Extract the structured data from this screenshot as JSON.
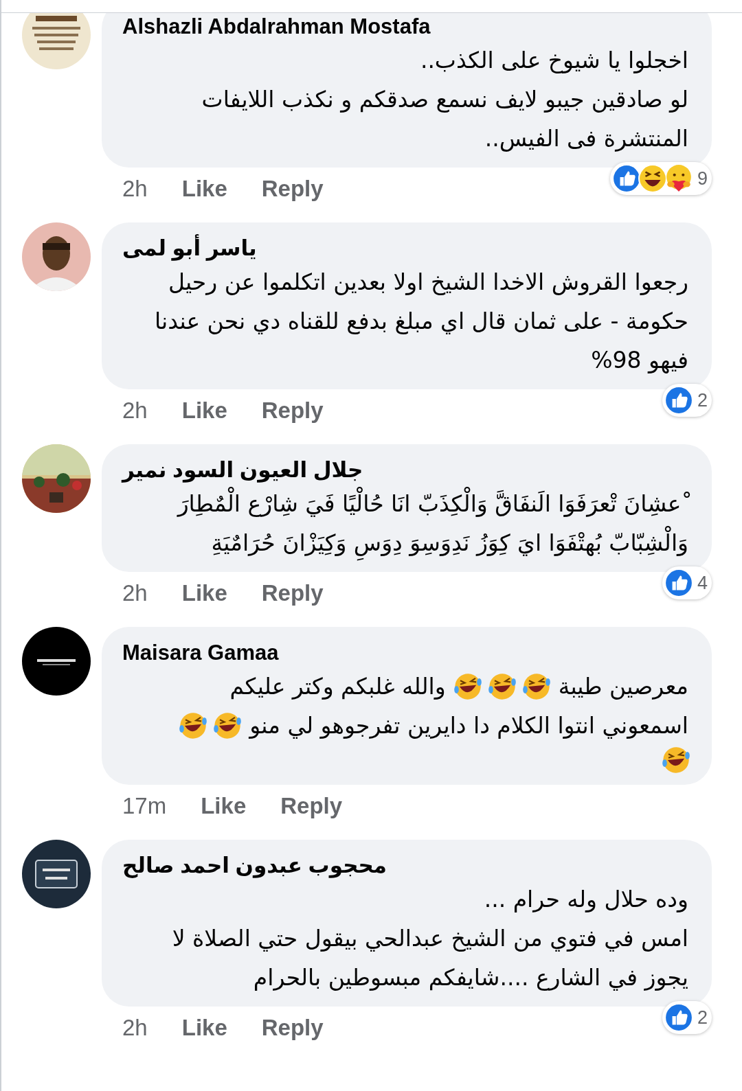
{
  "comments": [
    {
      "author": "Alshazli Abdalrahman Mostafa",
      "lines": [
        [
          {
            "kind": "text",
            "text": "اخجلوا يا شيوخ على الكذب.."
          }
        ],
        [
          {
            "kind": "text",
            "text": "لو صادقين جيبو لايف نسمع صدقكم و نكذب اللايفات"
          }
        ],
        [
          {
            "kind": "text",
            "text": "المنتشرة فى الفيس.."
          }
        ]
      ],
      "time": "2h",
      "like": "Like",
      "reply": "Reply",
      "reactions": [
        {
          "kind": "like"
        },
        {
          "kind": "haha"
        },
        {
          "kind": "care"
        }
      ],
      "reaction_count": "9"
    },
    {
      "author": "ياسر أبو لمى",
      "lines": [
        [
          {
            "kind": "text",
            "text": "رجعوا القروش الاخدا الشيخ اولا بعدين اتكلموا عن رحيل"
          }
        ],
        [
          {
            "kind": "text",
            "text": "حكومة - على ثمان قال اي مبلغ بدفع للقناه دي نحن عندنا"
          }
        ],
        [
          {
            "kind": "text",
            "text": "فيهو 98%"
          }
        ]
      ],
      "time": "2h",
      "like": "Like",
      "reply": "Reply",
      "reactions": [
        {
          "kind": "like"
        }
      ],
      "reaction_count": "2"
    },
    {
      "author": "جلال العيون السود نمير",
      "lines": [
        [
          {
            "kind": "text",
            "text": " ْعشِانَ تْعرَفَوَا الَنفَاقَّ وَالْكِذَبّ انَا حُالْيًا فَيَ شِارْع الْمٌطِارَ"
          }
        ],
        [
          {
            "kind": "text",
            "text": "وَالْشِبّابّ بُهتْفَوَا ايَ كِوَزُ نَدِوَسِوَ دِوَسِ وَكِيَزْانَ حُرَامٌيَةِ"
          }
        ]
      ],
      "time": "2h",
      "like": "Like",
      "reply": "Reply",
      "reactions": [
        {
          "kind": "like"
        }
      ],
      "reaction_count": "4"
    },
    {
      "author": "Maisara Gamaa",
      "lines": [
        [
          {
            "kind": "text",
            "text": "معرصين طيبة"
          },
          {
            "kind": "emoji"
          },
          {
            "kind": "emoji"
          },
          {
            "kind": "emoji"
          },
          {
            "kind": "text",
            "text": "والله غلبكم وكتر عليكم"
          }
        ],
        [
          {
            "kind": "text",
            "text": "اسمعوني انتوا الكلام دا دايرين تفرجوهو لي منو"
          },
          {
            "kind": "emoji"
          },
          {
            "kind": "emoji"
          }
        ],
        [
          {
            "kind": "emoji"
          }
        ]
      ],
      "time": "17m",
      "like": "Like",
      "reply": "Reply"
    },
    {
      "author": "محجوب عبدون احمد صالح",
      "lines": [
        [
          {
            "kind": "text",
            "text": "وده حلال وله حرام ..."
          }
        ],
        [
          {
            "kind": "text",
            "text": "امس في فتوي من الشيخ عبدالحي بيقول حتي الصلاة لا"
          }
        ],
        [
          {
            "kind": "text",
            "text": "يجوز في الشارع ....شايفكم مبسوطين بالحرام"
          }
        ]
      ],
      "time": "2h",
      "like": "Like",
      "reply": "Reply",
      "reactions": [
        {
          "kind": "like"
        }
      ],
      "reaction_count": "2"
    }
  ]
}
